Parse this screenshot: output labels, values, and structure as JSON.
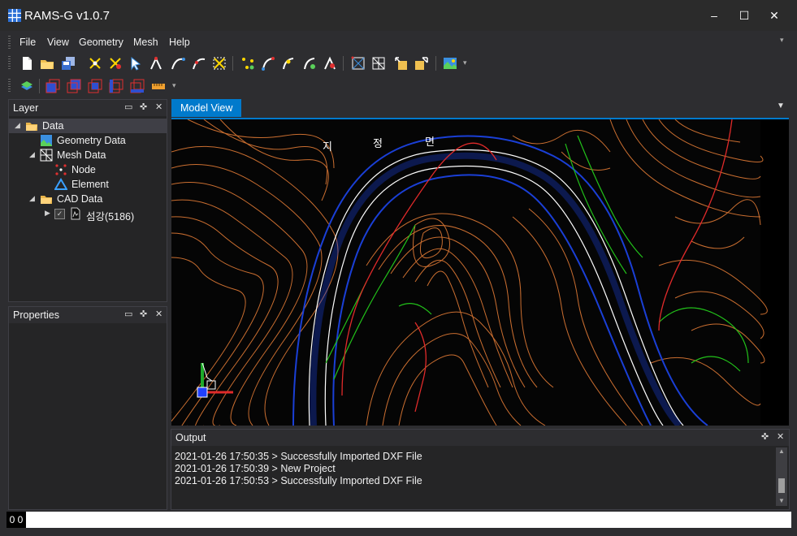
{
  "window": {
    "title": "RAMS-G v1.0.7",
    "minimize": "‒",
    "maximize": "☐",
    "close": "✕"
  },
  "menu": {
    "file": "File",
    "view": "View",
    "geometry": "Geometry",
    "mesh": "Mesh",
    "help": "Help"
  },
  "layer_panel": {
    "title": "Layer",
    "tree": {
      "data": "Data",
      "geometry_data": "Geometry Data",
      "mesh_data": "Mesh Data",
      "node": "Node",
      "element": "Element",
      "cad_data": "CAD Data",
      "cad_layer": "섬강(5186)"
    }
  },
  "properties_panel": {
    "title": "Properties"
  },
  "model_view": {
    "tab_label": "Model View",
    "map_label_1": "지",
    "map_label_2": "정",
    "map_label_3": "면"
  },
  "output_panel": {
    "title": "Output",
    "lines": [
      "2021-01-26 17:50:35 > Successfully Imported DXF File",
      "2021-01-26 17:50:39 > New Project",
      "2021-01-26 17:50:53 > Successfully Imported DXF File"
    ]
  },
  "status": {
    "text": "0 0"
  },
  "colors": {
    "accent": "#007acc",
    "contour": "#e07a35",
    "river": "#1a3fd6",
    "vegetation": "#22c21a",
    "road": "#e02a2a"
  }
}
